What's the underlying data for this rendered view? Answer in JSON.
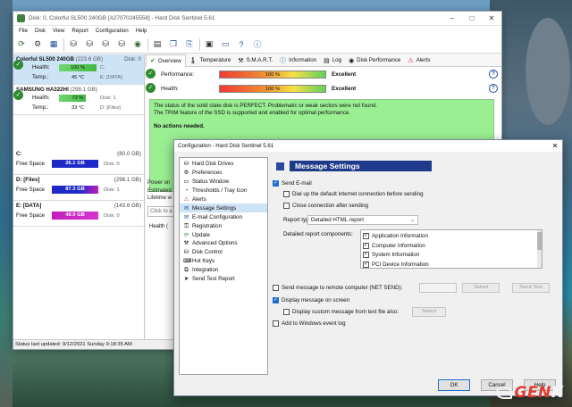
{
  "main_window": {
    "title": "Disk: 0, Colorful SL500 240GB [A27070245558]  -  Hard Disk Sentinel 5.61",
    "menu": [
      "File",
      "Disk",
      "View",
      "Report",
      "Configuration",
      "Help"
    ],
    "toolbar_icons": [
      "refresh-icon",
      "settings-gear-icon",
      "chart-icon",
      "disk-icon",
      "disk-icon",
      "disk-icon",
      "disk-icon",
      "globe-icon",
      "report-icon",
      "copy-icon",
      "network-icon",
      "chip-icon",
      "monitor-icon",
      "help-icon",
      "info-icon"
    ],
    "disks": [
      {
        "name": "Colorful SL500 240GB",
        "size": "(223.6 GB)",
        "disk_label": "Disk: 0",
        "health_label": "Health:",
        "health_value": "100 %",
        "health_drive": "C:",
        "temp_label": "Temp.:",
        "temp_value": "45 °C",
        "temp_drive": "E: [DATA]"
      },
      {
        "name": "SAMSUNG HA322HI",
        "size": "(298.1 GB)",
        "disk_label": "",
        "health_label": "Health:",
        "health_value": "72 %",
        "health_drive": "Disk: 1",
        "temp_label": "Temp.:",
        "temp_value": "33 °C",
        "temp_drive": "D: [Files]"
      }
    ],
    "volumes": [
      {
        "name": "C:",
        "size": "(80.0 GB)",
        "free_label": "Free Space",
        "free_value": "26.1 GB",
        "disk": "Disk: 0"
      },
      {
        "name": "D: [Files]",
        "size": "(298.1 GB)",
        "free_label": "Free Space",
        "free_value": "87.3 GB",
        "disk": "Disk: 1"
      },
      {
        "name": "E: [DATA]",
        "size": "(143.6 GB)",
        "free_label": "Free Space",
        "free_value": "49.9 GB",
        "disk": "Disk: 0"
      }
    ],
    "tabs": [
      "Overview",
      "Temperature",
      "S.M.A.R.T.",
      "Information",
      "Log",
      "Disk Performance",
      "Alerts"
    ],
    "performance": {
      "label": "Performance:",
      "value": "100 %",
      "state": "Excellent"
    },
    "health": {
      "label": "Health:",
      "value": "100 %",
      "state": "Excellent"
    },
    "message_line1": "The status of the solid state disk is PERFECT. Problematic or weak sectors were not found.",
    "message_line2": "The TRIM feature of the SSD is supported and enabled for optimal performance.",
    "message_actions": "No actions needed.",
    "lower_lines": [
      "Power on",
      "Estimated",
      "Lifetime w"
    ],
    "lower_box": "Click to a",
    "health_label2": "Health (",
    "status_text": "Status last updated: 9/12/2021 Sunday 9:18:35 AM"
  },
  "config_dialog": {
    "title": "Configuration  -  Hard Disk Sentinel 5.61",
    "tree": [
      {
        "label": "Hard Disk Drives",
        "icon": "disk-icon"
      },
      {
        "label": "Preferences",
        "icon": "gear-icon"
      },
      {
        "label": "Status Window",
        "icon": "window-icon"
      },
      {
        "label": "Thresholds / Tray Icon",
        "icon": "threshold-icon"
      },
      {
        "label": "Alerts",
        "icon": "alert-icon"
      },
      {
        "label": "Message Settings",
        "icon": "message-icon"
      },
      {
        "label": "E-mail Configuration",
        "icon": "email-icon"
      },
      {
        "label": "Registration",
        "icon": "key-icon"
      },
      {
        "label": "Update",
        "icon": "update-icon"
      },
      {
        "label": "Advanced Options",
        "icon": "advanced-icon"
      },
      {
        "label": "Disk Control",
        "icon": "disk-control-icon"
      },
      {
        "label": "Hot Keys",
        "icon": "keyboard-icon"
      },
      {
        "label": "Integration",
        "icon": "integration-icon"
      },
      {
        "label": "Send Test Report",
        "icon": "send-icon"
      }
    ],
    "selected_index": 5,
    "section_title": "Message Settings",
    "send_email": "Send E-mail",
    "dialup": "Dial up the default internet connection before sending",
    "close_conn": "Close connection after sending",
    "report_type_label": "Report type:",
    "report_type_value": "Detailed HTML report",
    "components_label": "Detailed report components:",
    "components": [
      "Application Information",
      "Computer Information",
      "System Information",
      "PCI Device Information"
    ],
    "send_net": "Send message to remote computer (NET SEND):",
    "select_btn": "Select",
    "send_test_btn": "Send Test",
    "display_msg": "Display message on screen",
    "display_custom": "Display custom message from text file also:",
    "select_btn2": "Select",
    "add_event_log": "Add to Windows event log",
    "ok": "OK",
    "cancel": "Cancel",
    "help": "Help"
  },
  "watermark": {
    "part1": "GEN",
    "part2": "K"
  },
  "colors": {
    "accent": "#1f3a8a",
    "good": "#42b842",
    "message_bg": "#9bef93",
    "free_blue": "#1d2ac8",
    "free_purple": "#c21dbc"
  }
}
